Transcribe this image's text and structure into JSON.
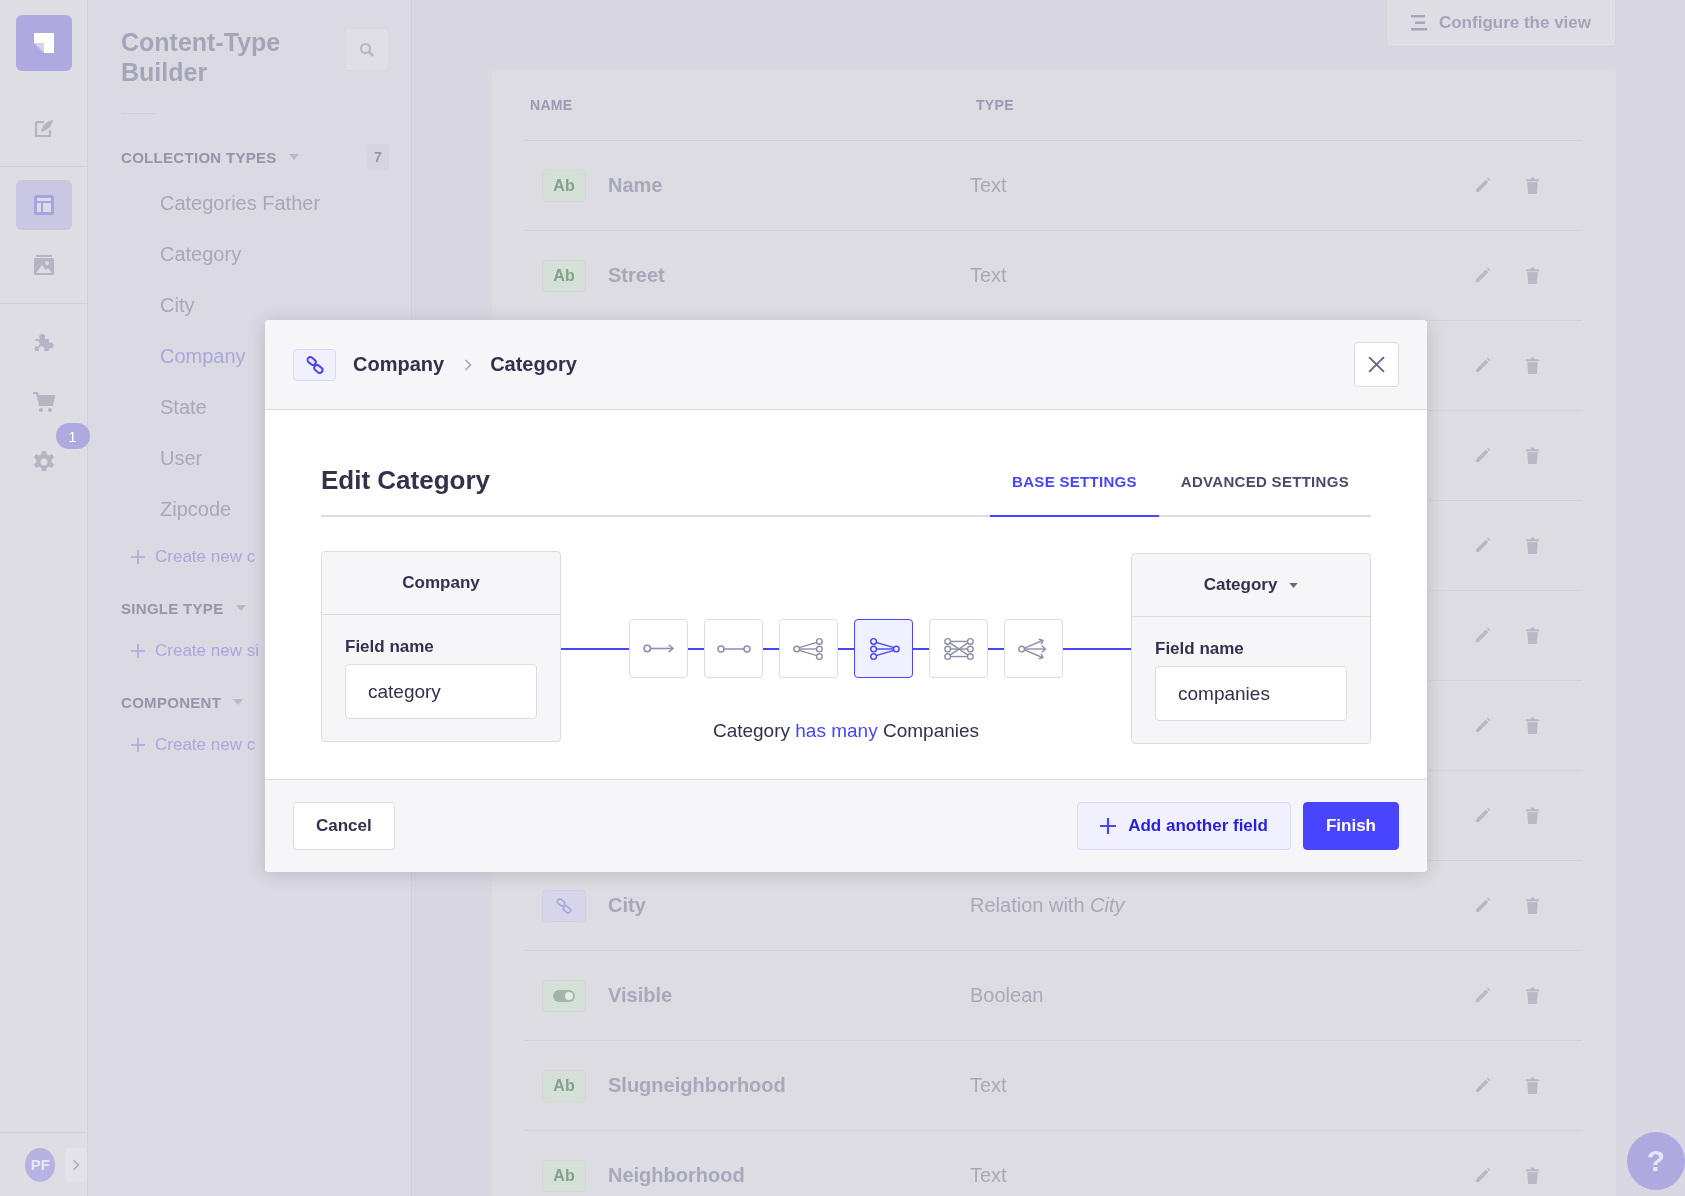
{
  "nav": {
    "items": [
      {
        "kind": "content",
        "selected": false
      },
      {
        "kind": "builder",
        "selected": true
      },
      {
        "kind": "media",
        "selected": false
      },
      {
        "kind": "plugins",
        "selected": false
      },
      {
        "kind": "market",
        "selected": false
      },
      {
        "kind": "settings",
        "selected": false,
        "badge": "1"
      }
    ],
    "avatar": "PF"
  },
  "sidebar": {
    "title": "Content-Type Builder",
    "sections": [
      {
        "heading": "COLLECTION TYPES",
        "count": "7",
        "items": [
          {
            "label": "Categories Father",
            "selected": false
          },
          {
            "label": "Category",
            "selected": false
          },
          {
            "label": "City",
            "selected": false
          },
          {
            "label": "Company",
            "selected": true
          },
          {
            "label": "State",
            "selected": false
          },
          {
            "label": "User",
            "selected": false
          },
          {
            "label": "Zipcode",
            "selected": false
          }
        ],
        "create": "Create new c"
      },
      {
        "heading": "SINGLE TYPE",
        "create": "Create new si"
      },
      {
        "heading": "COMPONENT",
        "create": "Create new c"
      }
    ]
  },
  "toolbar": {
    "configure": "Configure the view"
  },
  "table": {
    "columns": [
      "NAME",
      "TYPE"
    ],
    "rows": [
      {
        "kind": "text",
        "badge": "Ab",
        "name": "Name",
        "type": "Text"
      },
      {
        "kind": "text",
        "badge": "Ab",
        "name": "Street",
        "type": "Text"
      },
      {
        "kind": "covered"
      },
      {
        "kind": "covered"
      },
      {
        "kind": "covered"
      },
      {
        "kind": "covered"
      },
      {
        "kind": "covered"
      },
      {
        "kind": "covered"
      },
      {
        "kind": "relation",
        "name": "City",
        "type": "Relation with *City*"
      },
      {
        "kind": "boolean",
        "name": "Visible",
        "type": "Boolean"
      },
      {
        "kind": "text",
        "badge": "Ab",
        "name": "Slugneighborhood",
        "type": "Text"
      },
      {
        "kind": "text",
        "badge": "Ab",
        "name": "Neighborhood",
        "type": "Text"
      }
    ]
  },
  "modal": {
    "breadcrumb": [
      "Company",
      "Category"
    ],
    "title": "Edit Category",
    "tabs": [
      {
        "label": "BASE SETTINGS",
        "selected": true
      },
      {
        "label": "ADVANCED SETTINGS",
        "selected": false
      }
    ],
    "left": {
      "header": "Company",
      "field_label": "Field name",
      "value": "category"
    },
    "right": {
      "header": "Category",
      "field_label": "Field name",
      "value": "companies"
    },
    "relations": [
      {
        "kind": "one-way",
        "selected": false
      },
      {
        "kind": "one-to-one",
        "selected": false
      },
      {
        "kind": "one-to-many",
        "selected": false
      },
      {
        "kind": "many-to-one",
        "selected": true
      },
      {
        "kind": "many-to-many",
        "selected": false
      },
      {
        "kind": "many-way",
        "selected": false
      }
    ],
    "sentence": {
      "left": "Category",
      "verb": "has many",
      "right": "Companies"
    },
    "buttons": {
      "cancel": "Cancel",
      "add": "Add another field",
      "finish": "Finish"
    }
  },
  "help": "?"
}
